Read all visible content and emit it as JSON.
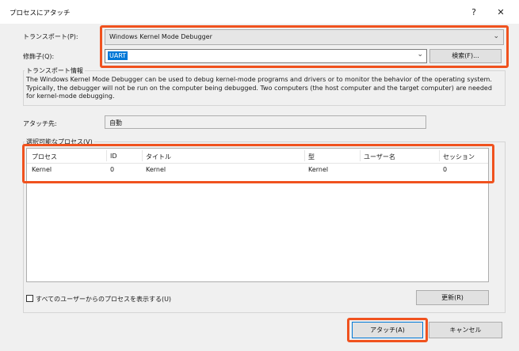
{
  "window": {
    "title": "プロセスにアタッチ",
    "help_label": "?",
    "close_label": "✕"
  },
  "transport": {
    "label": "トランスポート(P):",
    "value": "Windows Kernel Mode Debugger"
  },
  "qualifier": {
    "label": "修飾子(Q):",
    "value": "UART",
    "find_button": "検索(F)..."
  },
  "transport_info": {
    "title": "トランスポート情報",
    "text": "The Windows Kernel Mode Debugger can be used to debug kernel-mode programs and drivers or to monitor the behavior of the operating system. Typically, the debugger will not be run on the computer being debugged. Two computers (the host computer and the target computer) are needed for kernel-mode debugging."
  },
  "attach_to": {
    "label": "アタッチ先:",
    "value": "自動"
  },
  "processes": {
    "group_label": "選択可能なプロセス(V)",
    "columns": [
      "プロセス",
      "ID",
      "タイトル",
      "型",
      "ユーザー名",
      "セッション"
    ],
    "rows": [
      [
        "Kernel",
        "0",
        "Kernel",
        "Kernel",
        "",
        "0"
      ]
    ]
  },
  "show_all_users": {
    "label": "すべてのユーザーからのプロセスを表示する(U)",
    "checked": false
  },
  "refresh_button": "更新(R)",
  "attach_button": "アタッチ(A)",
  "cancel_button": "キャンセル",
  "colors": {
    "highlight": "#f0521e",
    "selection": "#0078d7",
    "dialog_bg": "#f0f0f0"
  }
}
